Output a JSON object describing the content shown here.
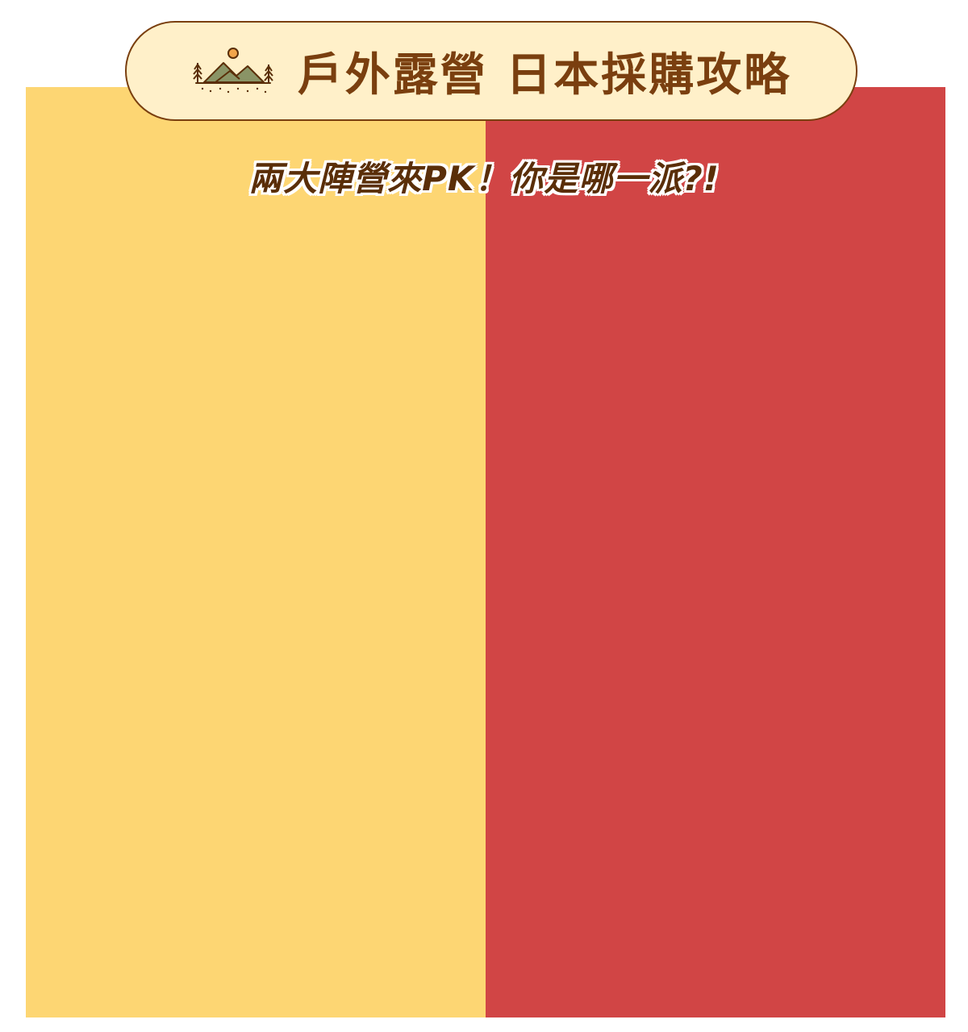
{
  "header": {
    "title": "戶外露營 日本採購攻略",
    "icon": "mountain-camp-icon"
  },
  "subtitle": "兩大陣營來PK！你是哪一派?!",
  "colors": {
    "title_text": "#7a3f0f",
    "pill_background": "#fff0c9",
    "left_panel": "#fdd673",
    "right_panel": "#d14545",
    "mountain": "#8a9466",
    "sun": "#f2a64b"
  }
}
